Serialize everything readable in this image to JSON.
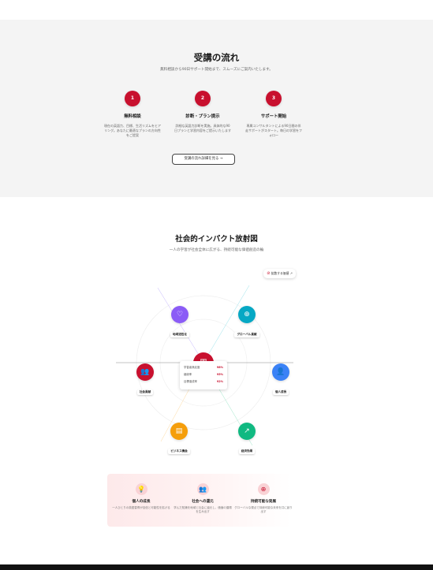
{
  "flow": {
    "title": "受講の流れ",
    "subtitle": "無料相談から90日サポート開始まで、スムーズにご案内いたします。",
    "steps": [
      {
        "num": "1",
        "title": "無料相談",
        "desc": "現在の英語力、目標、生活リズムをヒアリング。あなたに最適なプランの方向性をご提案"
      },
      {
        "num": "2",
        "title": "診断・プラン提示",
        "desc": "詳細な英語力診断を実施。具体的な90日プランと学習内容をご提示いたします"
      },
      {
        "num": "3",
        "title": "サポート開始",
        "desc": "専属コンサルタントによる90日間の伴走サポートがスタート。毎日の学習をフォロー"
      }
    ],
    "button_label": "受講の流れ詳細を見る →"
  },
  "impact": {
    "title": "社会的インパクト放射図",
    "subtitle": "一人の学習が社会全体に広がる、持続可能な価値創造の輪",
    "share_label": "拡散する価値",
    "share_icon": "link-icon",
    "nodes": [
      {
        "label": "地域活性化",
        "icon": "heart-icon",
        "glyph": "♡",
        "color": "#8b5cf6"
      },
      {
        "label": "グローバル貢献",
        "icon": "globe-icon",
        "glyph": "⊕",
        "color": "#06a8c4"
      },
      {
        "label": "社会貢献",
        "icon": "users-icon",
        "glyph": "👥",
        "color": "#c8102e"
      },
      {
        "label": "個人成長",
        "icon": "user-icon",
        "glyph": "👤",
        "color": "#3b82f6"
      },
      {
        "label": "ビジネス機会",
        "icon": "document-icon",
        "glyph": "▤",
        "color": "#f59e0b"
      },
      {
        "label": "経済効果",
        "icon": "trend-up-icon",
        "glyph": "↗",
        "color": "#10b981"
      }
    ],
    "center_icon": "book-icon",
    "stats": [
      {
        "label": "学習者満足度",
        "value": "98%"
      },
      {
        "label": "継続率",
        "value": "95%"
      },
      {
        "label": "目標達成率",
        "value": "92%"
      }
    ],
    "bottom": [
      {
        "icon": "lightbulb-icon",
        "glyph": "💡",
        "title": "個人の成長",
        "desc": "一人ひとりの英語習得が自信と可能性を拡げる"
      },
      {
        "icon": "people-icon",
        "glyph": "👥",
        "title": "社会への還元",
        "desc": "学んだ知識を地域と社会に還元し、価値の循環を生み出す"
      },
      {
        "icon": "globe-icon",
        "glyph": "⊕",
        "title": "持続可能な発展",
        "desc": "グローバルな視点で持続可能な未来を共に創り出す"
      }
    ]
  },
  "colors": {
    "accent": "#c8102e",
    "flow_bg": "#f4f4f4"
  }
}
